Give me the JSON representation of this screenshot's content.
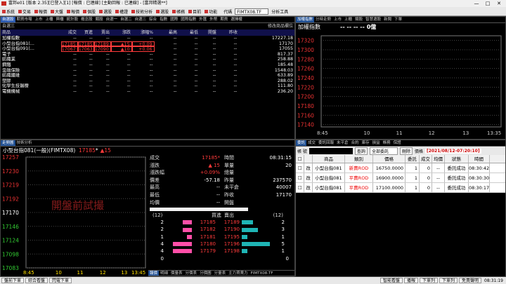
{
  "window": {
    "title": "富邦e01 [版本 2.35][已登入][1] [報價 : 已連線] [主動回報 : 已連線] - [富邦精選**]",
    "minimize": "—",
    "maximize": "□",
    "close": "✕"
  },
  "menu": {
    "items": [
      "系統",
      "交易",
      "報價",
      "大盤",
      "報價",
      "個股",
      "選股",
      "權證",
      "技術分析",
      "選股",
      "帳務",
      "目前",
      "功能"
    ],
    "symbol_label": "代碼",
    "symbol_value": "FIMTX08.TF",
    "analysis": "分析工具"
  },
  "colors": {
    "accent_tab": "#2d5cb2",
    "up": "#ff3b3b",
    "down": "#39e039",
    "yellow": "#ffe000"
  },
  "market": {
    "tabs": [
      "自選股",
      "期貨市場",
      "上市",
      "上櫃",
      "興櫃",
      "統計股",
      "概念股",
      "類股",
      "自選一",
      "自選二",
      "自選三",
      "綜合",
      "指數",
      "國際",
      "國際指數",
      "外匯",
      "外幣",
      "期貨",
      "選擇權"
    ],
    "headers": [
      "商品",
      "成交",
      "買進",
      "賣出",
      "漲跌",
      "漲幅%",
      "最高",
      "最低",
      "開盤",
      "昨收"
    ],
    "sub_header": "自選三",
    "edit_label": "修改商品欄位",
    "rows": [
      {
        "name": "加權指數",
        "cols": [
          "--",
          "--",
          "--",
          "--",
          "--",
          "--",
          "--",
          "--",
          "--",
          "17227.18"
        ],
        "cls": "wht"
      },
      {
        "name": "小型台指081(…",
        "cols": [
          "17185",
          "17185",
          "17189",
          "▲15",
          "+0.09",
          "--",
          "--",
          "--",
          "--",
          "17170"
        ],
        "cls": "red",
        "sel": true
      },
      {
        "name": "小型台指091(…",
        "cols": [
          "17067",
          "17063",
          "17090",
          "▲10",
          "+0.06",
          "--",
          "--",
          "--",
          "--",
          "17055"
        ],
        "cls": "red",
        "sel": true
      },
      {
        "name": "電子",
        "cols": [
          "--",
          "--",
          "--",
          "--",
          "--",
          "--",
          "--",
          "--",
          "--",
          "817.37"
        ],
        "cls": "wht"
      },
      {
        "name": "紡織業",
        "cols": [
          "--",
          "--",
          "--",
          "--",
          "--",
          "--",
          "--",
          "--",
          "--",
          "258.88"
        ],
        "cls": "wht"
      },
      {
        "name": "鋼鐵",
        "cols": [
          "--",
          "--",
          "--",
          "--",
          "--",
          "--",
          "--",
          "--",
          "--",
          "185.48"
        ],
        "cls": "wht"
      },
      {
        "name": "金融保險",
        "cols": [
          "--",
          "--",
          "--",
          "--",
          "--",
          "--",
          "--",
          "--",
          "--",
          "1548.03"
        ],
        "cls": "wht"
      },
      {
        "name": "紡織纖維",
        "cols": [
          "--",
          "--",
          "--",
          "--",
          "--",
          "--",
          "--",
          "--",
          "--",
          "633.89"
        ],
        "cls": "wht"
      },
      {
        "name": "塑膠",
        "cols": [
          "--",
          "--",
          "--",
          "--",
          "--",
          "--",
          "--",
          "--",
          "--",
          "288.02"
        ],
        "cls": "wht"
      },
      {
        "name": "化學生技醫療",
        "cols": [
          "--",
          "--",
          "--",
          "--",
          "--",
          "--",
          "--",
          "--",
          "--",
          "111.80"
        ],
        "cls": "wht"
      },
      {
        "name": "電機機械",
        "cols": [
          "--",
          "--",
          "--",
          "--",
          "--",
          "--",
          "--",
          "--",
          "--",
          "236.20"
        ],
        "cls": "wht"
      }
    ]
  },
  "index_chart": {
    "tabs": [
      "加權指數",
      "分時走勢",
      "上市",
      "上櫃",
      "類股",
      "智慧選股",
      "新聞",
      "下單"
    ],
    "title": "加權指數",
    "readout": "-- -- -- -- 0億",
    "chart_data": {
      "type": "line",
      "x": [
        "8:45",
        "10",
        "11",
        "12",
        "13",
        "13:35"
      ],
      "yticks": [
        17320,
        17300,
        17280,
        17260,
        17240,
        17220,
        17200,
        17180,
        17160,
        17140
      ],
      "ylim": [
        17135,
        17330
      ],
      "values": []
    }
  },
  "quote": {
    "tabs": [
      "走勢圖",
      "技術分析"
    ],
    "name": "小型台指081(一般)(FIMTX08)",
    "price": "17185",
    "star": "*",
    "change": "▲15",
    "watermark": "開盤前試撮",
    "kv": [
      {
        "k": "成交",
        "v": "17185*",
        "c": "red",
        "k2": "時間",
        "v2": "08:31:15"
      },
      {
        "k": "漲跌",
        "v": "▲ 15",
        "c": "red",
        "k2": "單量",
        "v2": "20"
      },
      {
        "k": "漲跌幅",
        "v": "+0.09%",
        "c": "red",
        "k2": "總量",
        "v2": ""
      },
      {
        "k": "價差",
        "v": "-57.18",
        "c": "wht",
        "k2": "昨量",
        "v2": "237570"
      },
      {
        "k": "最高",
        "v": "--",
        "c": "wht",
        "k2": "未平倉",
        "v2": "40007"
      },
      {
        "k": "最低",
        "v": "--",
        "c": "wht",
        "k2": "昨收",
        "v2": "17170"
      },
      {
        "k": "均價",
        "v": "--",
        "c": "wht",
        "k2": "開盤",
        "v2": ""
      }
    ],
    "book_header": {
      "left": "(12)",
      "buy": "買進",
      "sell": "賣出",
      "right": "(12)"
    },
    "book": [
      {
        "bq": "2",
        "bp": "17185",
        "sp": "17189",
        "sq": "2",
        "bw": 0.35,
        "sw": 0.35
      },
      {
        "bq": "2",
        "bp": "17182",
        "sp": "17190",
        "sq": "3",
        "bw": 0.35,
        "sw": 0.5
      },
      {
        "bq": "1",
        "bp": "17181",
        "sp": "17195",
        "sq": "1",
        "bw": 0.18,
        "sw": 0.18
      },
      {
        "bq": "4",
        "bp": "17180",
        "sp": "17196",
        "sq": "5",
        "bw": 0.7,
        "sw": 0.88
      },
      {
        "bq": "4",
        "bp": "17179",
        "sp": "17198",
        "sq": "1",
        "bw": 0.7,
        "sw": 0.18
      }
    ],
    "book_total": {
      "bq": "0",
      "sq": "0"
    },
    "bottom_tabs": [
      "報價",
      "明細",
      "價量表",
      "分價表",
      "分價圖",
      "分量表",
      "主力買賣力",
      "FIMTX08.TF"
    ],
    "chart_data": {
      "type": "line",
      "x": [
        "8:45",
        "10",
        "11",
        "12",
        "13",
        "13:45"
      ],
      "yticks": [
        17257,
        17230,
        17219,
        17192,
        17170,
        17146,
        17124,
        17098,
        17083
      ],
      "ylim": [
        17080,
        17260
      ],
      "values": []
    }
  },
  "orders": {
    "tabs": [
      "委託",
      "成交",
      "委託回報",
      "未平倉",
      "合約",
      "庫存",
      "損益",
      "帳務",
      "保證"
    ],
    "account_label": "帳 號",
    "query": "查詢",
    "filter": "全部委託",
    "delete": "刪除",
    "time_filter": "價格",
    "datetime": "[2021/08/12-07:20:10]",
    "headers": [
      "商品",
      "類別",
      "價格",
      "委託",
      "成交",
      "均價",
      "狀態",
      "時間"
    ],
    "rows": [
      {
        "change": "改",
        "product": "小型台指081",
        "type": "新賣ROD",
        "price": "16750.0000",
        "qty": "1",
        "fill": "0",
        "avg": "--",
        "status": "委託成功",
        "time": "08:30:42"
      },
      {
        "change": "改",
        "product": "小型台指081",
        "type": "平賣ROD",
        "price": "16900.0000",
        "qty": "1",
        "fill": "0",
        "avg": "--",
        "status": "委託成功",
        "time": "08:30:30"
      },
      {
        "change": "改",
        "product": "小型台指081",
        "type": "平賣ROD",
        "price": "17100.0000",
        "qty": "1",
        "fill": "0",
        "avg": "--",
        "status": "委託成功",
        "time": "08:30:17"
      }
    ]
  },
  "status": {
    "left": [
      "盤前下單",
      "綜合看盤",
      "閃電下單"
    ],
    "right": [
      "智能看盤",
      "播報",
      "下單列",
      "下單列",
      "免責聲明"
    ],
    "time": "08:31:19"
  }
}
